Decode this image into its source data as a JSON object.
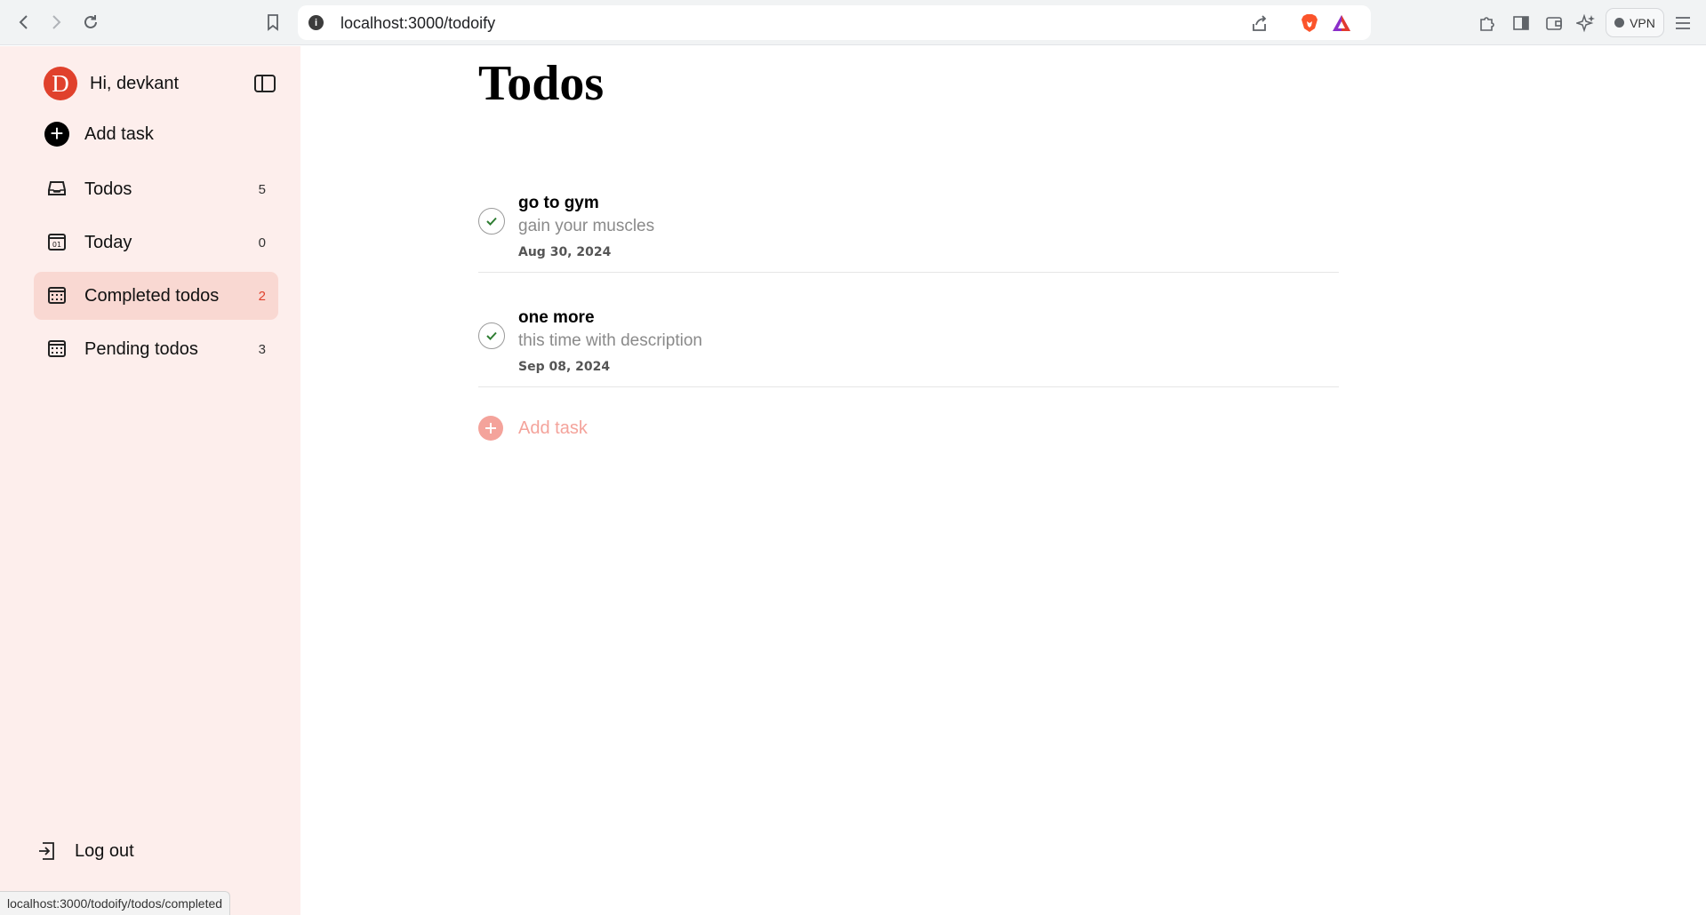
{
  "browser": {
    "url": "localhost:3000/todoify",
    "vpn_label": "VPN",
    "status_url": "localhost:3000/todoify/todos/completed"
  },
  "sidebar": {
    "avatar_letter": "D",
    "greeting": "Hi, devkant",
    "add_task_label": "Add task",
    "items": [
      {
        "label": "Todos",
        "count": "5",
        "icon": "inbox-icon",
        "active": false
      },
      {
        "label": "Today",
        "count": "0",
        "icon": "calendar-day-icon",
        "active": false
      },
      {
        "label": "Completed todos",
        "count": "2",
        "icon": "calendar-grid-icon",
        "active": true
      },
      {
        "label": "Pending todos",
        "count": "3",
        "icon": "calendar-grid-icon",
        "active": false
      }
    ],
    "logout_label": "Log out"
  },
  "main": {
    "title": "Todos",
    "tasks": [
      {
        "title": "go to gym",
        "description": "gain your muscles",
        "date": "Aug 30, 2024",
        "completed": true
      },
      {
        "title": "one more",
        "description": "this time with description",
        "date": "Sep 08, 2024",
        "completed": true
      }
    ],
    "add_task_label": "Add task"
  },
  "colors": {
    "sidebar_bg": "#fdeeec",
    "active_item_bg": "#f9d8d2",
    "accent": "#e0412c",
    "add_task_muted": "#f4a39b",
    "check_green": "#2e7d32"
  }
}
